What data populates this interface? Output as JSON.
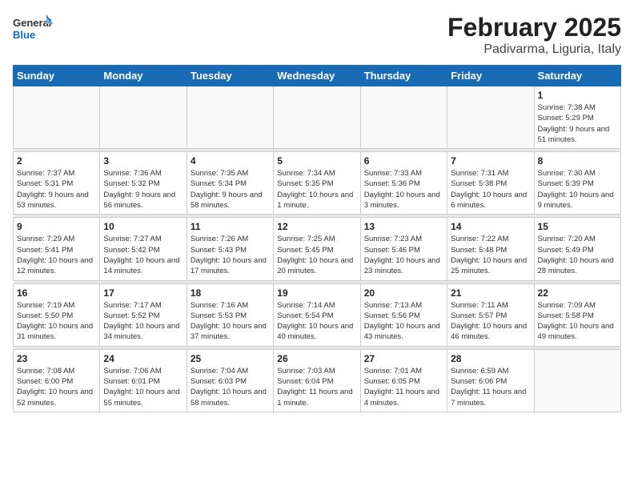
{
  "logo": {
    "general": "General",
    "blue": "Blue"
  },
  "title": "February 2025",
  "subtitle": "Padivarma, Liguria, Italy",
  "weekdays": [
    "Sunday",
    "Monday",
    "Tuesday",
    "Wednesday",
    "Thursday",
    "Friday",
    "Saturday"
  ],
  "weeks": [
    [
      {
        "day": "",
        "info": ""
      },
      {
        "day": "",
        "info": ""
      },
      {
        "day": "",
        "info": ""
      },
      {
        "day": "",
        "info": ""
      },
      {
        "day": "",
        "info": ""
      },
      {
        "day": "",
        "info": ""
      },
      {
        "day": "1",
        "info": "Sunrise: 7:38 AM\nSunset: 5:29 PM\nDaylight: 9 hours and 51 minutes."
      }
    ],
    [
      {
        "day": "2",
        "info": "Sunrise: 7:37 AM\nSunset: 5:31 PM\nDaylight: 9 hours and 53 minutes."
      },
      {
        "day": "3",
        "info": "Sunrise: 7:36 AM\nSunset: 5:32 PM\nDaylight: 9 hours and 56 minutes."
      },
      {
        "day": "4",
        "info": "Sunrise: 7:35 AM\nSunset: 5:34 PM\nDaylight: 9 hours and 58 minutes."
      },
      {
        "day": "5",
        "info": "Sunrise: 7:34 AM\nSunset: 5:35 PM\nDaylight: 10 hours and 1 minute."
      },
      {
        "day": "6",
        "info": "Sunrise: 7:33 AM\nSunset: 5:36 PM\nDaylight: 10 hours and 3 minutes."
      },
      {
        "day": "7",
        "info": "Sunrise: 7:31 AM\nSunset: 5:38 PM\nDaylight: 10 hours and 6 minutes."
      },
      {
        "day": "8",
        "info": "Sunrise: 7:30 AM\nSunset: 5:39 PM\nDaylight: 10 hours and 9 minutes."
      }
    ],
    [
      {
        "day": "9",
        "info": "Sunrise: 7:29 AM\nSunset: 5:41 PM\nDaylight: 10 hours and 12 minutes."
      },
      {
        "day": "10",
        "info": "Sunrise: 7:27 AM\nSunset: 5:42 PM\nDaylight: 10 hours and 14 minutes."
      },
      {
        "day": "11",
        "info": "Sunrise: 7:26 AM\nSunset: 5:43 PM\nDaylight: 10 hours and 17 minutes."
      },
      {
        "day": "12",
        "info": "Sunrise: 7:25 AM\nSunset: 5:45 PM\nDaylight: 10 hours and 20 minutes."
      },
      {
        "day": "13",
        "info": "Sunrise: 7:23 AM\nSunset: 5:46 PM\nDaylight: 10 hours and 23 minutes."
      },
      {
        "day": "14",
        "info": "Sunrise: 7:22 AM\nSunset: 5:48 PM\nDaylight: 10 hours and 25 minutes."
      },
      {
        "day": "15",
        "info": "Sunrise: 7:20 AM\nSunset: 5:49 PM\nDaylight: 10 hours and 28 minutes."
      }
    ],
    [
      {
        "day": "16",
        "info": "Sunrise: 7:19 AM\nSunset: 5:50 PM\nDaylight: 10 hours and 31 minutes."
      },
      {
        "day": "17",
        "info": "Sunrise: 7:17 AM\nSunset: 5:52 PM\nDaylight: 10 hours and 34 minutes."
      },
      {
        "day": "18",
        "info": "Sunrise: 7:16 AM\nSunset: 5:53 PM\nDaylight: 10 hours and 37 minutes."
      },
      {
        "day": "19",
        "info": "Sunrise: 7:14 AM\nSunset: 5:54 PM\nDaylight: 10 hours and 40 minutes."
      },
      {
        "day": "20",
        "info": "Sunrise: 7:13 AM\nSunset: 5:56 PM\nDaylight: 10 hours and 43 minutes."
      },
      {
        "day": "21",
        "info": "Sunrise: 7:11 AM\nSunset: 5:57 PM\nDaylight: 10 hours and 46 minutes."
      },
      {
        "day": "22",
        "info": "Sunrise: 7:09 AM\nSunset: 5:58 PM\nDaylight: 10 hours and 49 minutes."
      }
    ],
    [
      {
        "day": "23",
        "info": "Sunrise: 7:08 AM\nSunset: 6:00 PM\nDaylight: 10 hours and 52 minutes."
      },
      {
        "day": "24",
        "info": "Sunrise: 7:06 AM\nSunset: 6:01 PM\nDaylight: 10 hours and 55 minutes."
      },
      {
        "day": "25",
        "info": "Sunrise: 7:04 AM\nSunset: 6:03 PM\nDaylight: 10 hours and 58 minutes."
      },
      {
        "day": "26",
        "info": "Sunrise: 7:03 AM\nSunset: 6:04 PM\nDaylight: 11 hours and 1 minute."
      },
      {
        "day": "27",
        "info": "Sunrise: 7:01 AM\nSunset: 6:05 PM\nDaylight: 11 hours and 4 minutes."
      },
      {
        "day": "28",
        "info": "Sunrise: 6:59 AM\nSunset: 6:06 PM\nDaylight: 11 hours and 7 minutes."
      },
      {
        "day": "",
        "info": ""
      }
    ]
  ]
}
